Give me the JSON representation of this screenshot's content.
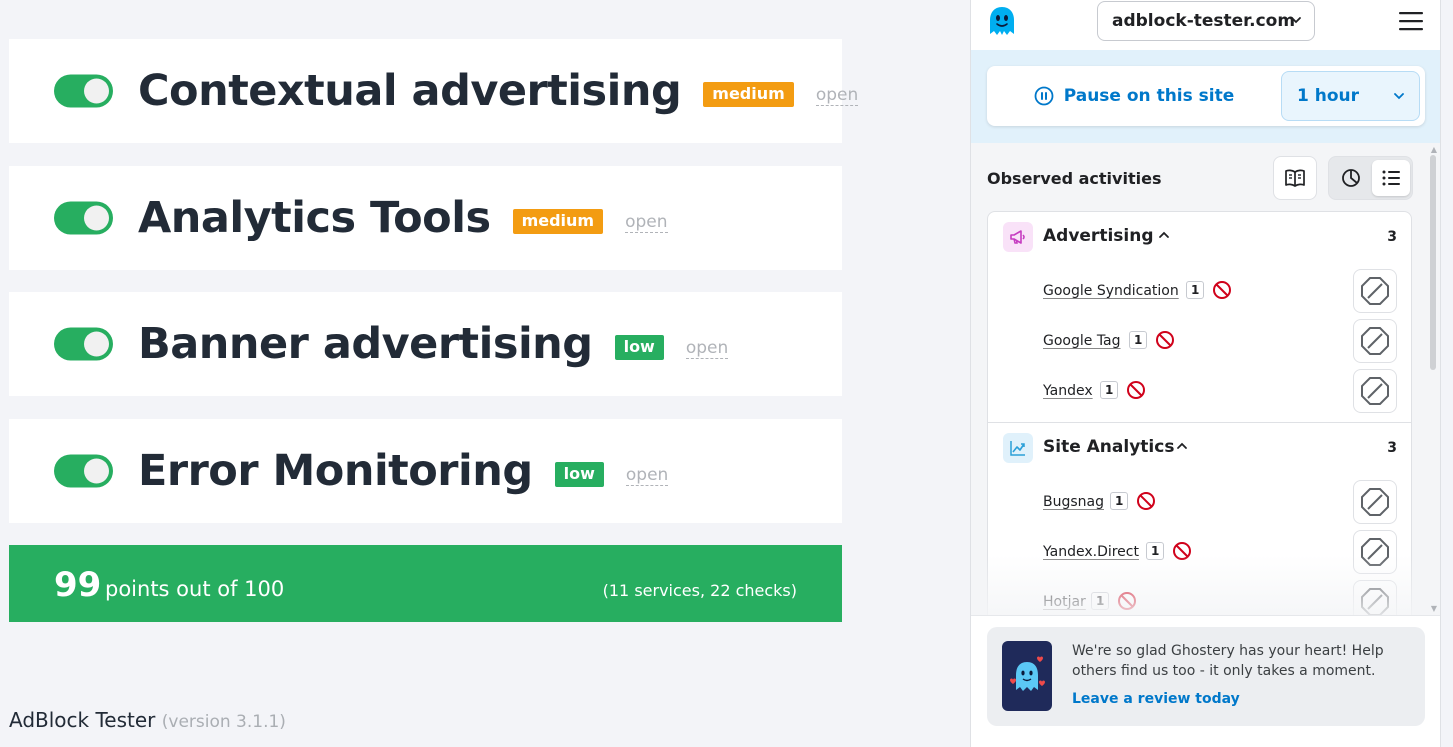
{
  "tester": {
    "cards": [
      {
        "title": "Contextual advertising",
        "level": "medium",
        "open_label": "open"
      },
      {
        "title": "Analytics Tools",
        "level": "medium",
        "open_label": "open"
      },
      {
        "title": "Banner advertising",
        "level": "low",
        "open_label": "open"
      },
      {
        "title": "Error Monitoring",
        "level": "low",
        "open_label": "open"
      }
    ],
    "score": {
      "points": "99",
      "text": "points out of 100",
      "summary": "(11 services, 22 checks)"
    },
    "footer": {
      "app_name": "AdBlock Tester",
      "version": "(version 3.1.1)"
    }
  },
  "extension": {
    "site": "adblock-tester.com",
    "pause_label": "Pause on this site",
    "pause_duration": "1 hour",
    "observed_title": "Observed activities",
    "categories": [
      {
        "name": "Advertising",
        "count": "3",
        "trackers": [
          {
            "name": "Google Syndication",
            "count": "1"
          },
          {
            "name": "Google Tag",
            "count": "1"
          },
          {
            "name": "Yandex",
            "count": "1"
          }
        ]
      },
      {
        "name": "Site Analytics",
        "count": "3",
        "trackers": [
          {
            "name": "Bugsnag",
            "count": "1"
          },
          {
            "name": "Yandex.Direct",
            "count": "1"
          },
          {
            "name": "Hotjar",
            "count": "1"
          }
        ]
      }
    ],
    "review": {
      "text": "We're so glad Ghostery has your heart! Help others find us too - it only takes a moment.",
      "link": "Leave a review today"
    }
  },
  "colors": {
    "green": "#27ae60",
    "orange": "#f39c12",
    "ghostery_blue": "#0078ca",
    "block_red": "#d0021b"
  }
}
